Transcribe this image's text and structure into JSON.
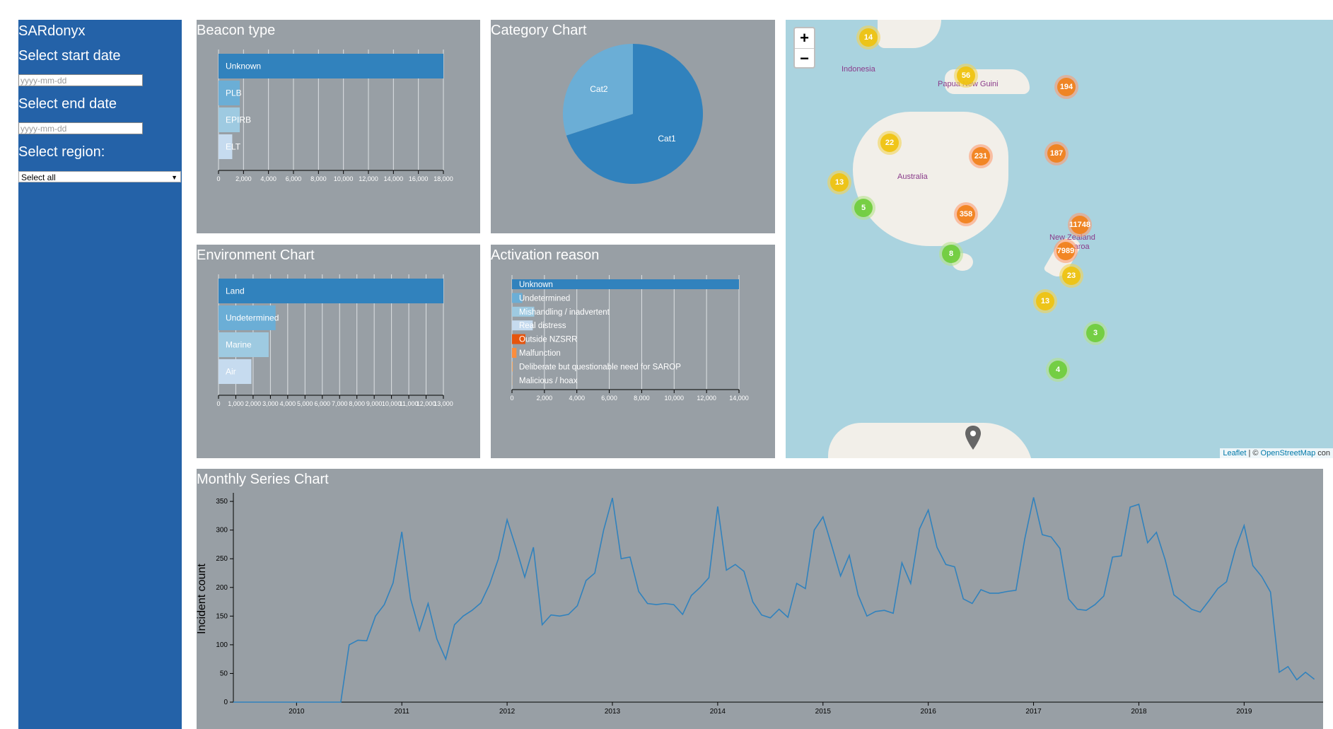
{
  "sidebar": {
    "title": "SARdonyx",
    "start_label": "Select start date",
    "start_placeholder": "yyyy-mm-dd",
    "end_label": "Select end date",
    "end_placeholder": "yyyy-mm-dd",
    "region_label": "Select region:",
    "region_value": "Select all"
  },
  "beacon": {
    "title": "Beacon type",
    "chart_data": {
      "type": "bar",
      "orientation": "horizontal",
      "categories": [
        "Unknown",
        "PLB",
        "EPIRB",
        "ELT"
      ],
      "values": [
        18000,
        1700,
        1700,
        1100
      ],
      "ticks": [
        "0",
        "2,000",
        "4,000",
        "6,000",
        "8,000",
        "10,000",
        "12,000",
        "14,000",
        "16,000",
        "18,000"
      ],
      "xlim": [
        0,
        18000
      ],
      "colors": [
        "#3182bd",
        "#6baed6",
        "#9ecae1",
        "#c6dbef"
      ]
    }
  },
  "category": {
    "title": "Category Chart",
    "chart_data": {
      "type": "pie",
      "labels": [
        "Cat1",
        "Cat2"
      ],
      "values": [
        70,
        30
      ],
      "colors": [
        "#3182bd",
        "#6baed6"
      ]
    }
  },
  "environment": {
    "title": "Environment Chart",
    "chart_data": {
      "type": "bar",
      "orientation": "horizontal",
      "categories": [
        "Land",
        "Undetermined",
        "Marine",
        "Air"
      ],
      "values": [
        13000,
        3300,
        2900,
        1900
      ],
      "ticks": [
        "0",
        "1,000",
        "2,000",
        "3,000",
        "4,000",
        "5,000",
        "6,000",
        "7,000",
        "8,000",
        "9,000",
        "10,000",
        "11,000",
        "12,000",
        "13,000"
      ],
      "xlim": [
        0,
        13000
      ],
      "colors": [
        "#3182bd",
        "#6baed6",
        "#9ecae1",
        "#c6dbef"
      ]
    }
  },
  "activation": {
    "title": "Activation reason",
    "chart_data": {
      "type": "bar",
      "orientation": "horizontal",
      "categories": [
        "Unknown",
        "Undetermined",
        "Mishandling / inadvertent",
        "Real distress",
        "Outside NZSRR",
        "Malfunction",
        "Deliberate but questionable need for SAROP",
        "Malicious / hoax"
      ],
      "values": [
        15300,
        700,
        1500,
        1400,
        900,
        300,
        50,
        20
      ],
      "ticks": [
        "0",
        "2,000",
        "4,000",
        "6,000",
        "8,000",
        "10,000",
        "12,000",
        "14,000"
      ],
      "xlim": [
        0,
        15300
      ],
      "colors": [
        "#3182bd",
        "#6baed6",
        "#9ecae1",
        "#c6dbef",
        "#e6550d",
        "#fd8d3c",
        "#fdae6b",
        "#fdd0a2"
      ]
    }
  },
  "monthly": {
    "title": "Monthly Series Chart",
    "chart_data": {
      "type": "line",
      "ylabel": "Incident count",
      "ylim": [
        0,
        360
      ],
      "yticks": [
        "0",
        "50",
        "100",
        "150",
        "200",
        "250",
        "300",
        "350"
      ],
      "xlim": [
        2009.4,
        2019.75
      ],
      "xticks": [
        "2010",
        "2011",
        "2012",
        "2013",
        "2014",
        "2015",
        "2016",
        "2017",
        "2018",
        "2019"
      ],
      "x": [
        2009.4,
        2010.42,
        2010.5,
        2010.583,
        2010.667,
        2010.75,
        2010.833,
        2010.917,
        2011.0,
        2011.083,
        2011.167,
        2011.25,
        2011.333,
        2011.417,
        2011.5,
        2011.583,
        2011.667,
        2011.75,
        2011.833,
        2011.917,
        2012.0,
        2012.083,
        2012.167,
        2012.25,
        2012.333,
        2012.417,
        2012.5,
        2012.583,
        2012.667,
        2012.75,
        2012.833,
        2012.917,
        2013.0,
        2013.083,
        2013.167,
        2013.25,
        2013.333,
        2013.417,
        2013.5,
        2013.583,
        2013.667,
        2013.75,
        2013.833,
        2013.917,
        2014.0,
        2014.083,
        2014.167,
        2014.25,
        2014.333,
        2014.417,
        2014.5,
        2014.583,
        2014.667,
        2014.75,
        2014.833,
        2014.917,
        2015.0,
        2015.083,
        2015.167,
        2015.25,
        2015.333,
        2015.417,
        2015.5,
        2015.583,
        2015.667,
        2015.75,
        2015.833,
        2015.917,
        2016.0,
        2016.083,
        2016.167,
        2016.25,
        2016.333,
        2016.417,
        2016.5,
        2016.583,
        2016.667,
        2016.75,
        2016.833,
        2016.917,
        2017.0,
        2017.083,
        2017.167,
        2017.25,
        2017.333,
        2017.417,
        2017.5,
        2017.583,
        2017.667,
        2017.75,
        2017.833,
        2017.917,
        2018.0,
        2018.083,
        2018.167,
        2018.25,
        2018.333,
        2018.417,
        2018.5,
        2018.583,
        2018.667,
        2018.75,
        2018.833,
        2018.917,
        2019.0,
        2019.083,
        2019.167,
        2019.25,
        2019.333,
        2019.417,
        2019.5,
        2019.583,
        2019.667,
        2019.75
      ],
      "y": [
        0,
        0,
        100,
        108,
        107,
        150,
        170,
        208,
        297,
        180,
        125,
        172,
        110,
        75,
        135,
        150,
        160,
        173,
        205,
        250,
        318,
        270,
        218,
        270,
        135,
        152,
        150,
        153,
        168,
        212,
        225,
        300,
        356,
        250,
        253,
        193,
        172,
        170,
        172,
        170,
        153,
        186,
        200,
        217,
        341,
        230,
        240,
        228,
        175,
        152,
        147,
        162,
        148,
        207,
        198,
        300,
        323,
        273,
        220,
        256,
        187,
        150,
        158,
        160,
        155,
        243,
        207,
        302,
        335,
        270,
        240,
        236,
        180,
        172,
        196,
        190,
        190,
        193,
        195,
        285,
        357,
        292,
        288,
        268,
        180,
        162,
        160,
        170,
        185,
        253,
        255,
        340,
        345,
        278,
        296,
        248,
        187,
        175,
        162,
        157,
        177,
        198,
        210,
        267,
        308,
        238,
        219,
        192,
        52,
        62,
        39,
        52,
        40
      ],
      "color": "#3182bd"
    }
  },
  "map": {
    "zoom_in": "+",
    "zoom_out": "−",
    "labels": [
      "Indonesia",
      "Papua New Guini",
      "Australia",
      "New Zealand",
      "Aotearoa"
    ],
    "clusters": [
      "14",
      "56",
      "194",
      "22",
      "231",
      "187",
      "13",
      "5",
      "358",
      "11748",
      "7989",
      "8",
      "23",
      "13",
      "3",
      "4"
    ],
    "attribution_leaflet": "Leaflet",
    "attribution_sep": " | © ",
    "attribution_osm": "OpenStreetMap",
    "attribution_tail": " con"
  }
}
